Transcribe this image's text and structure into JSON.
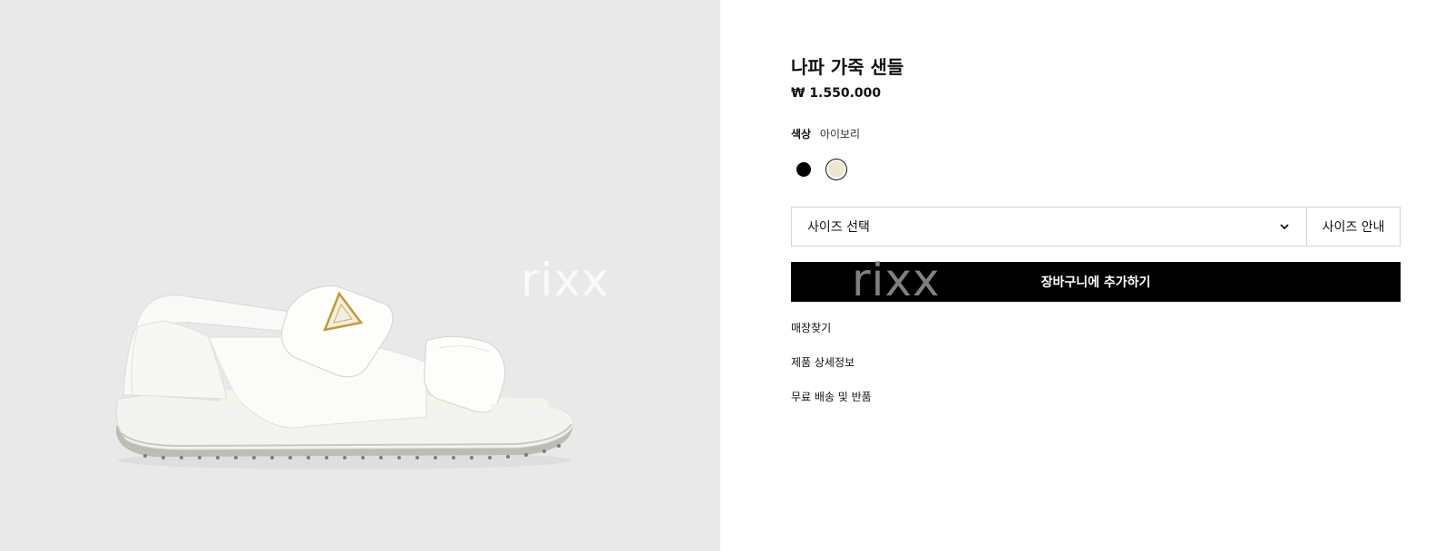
{
  "product": {
    "title": "나파 가죽 샌들",
    "price": "₩ 1.550.000",
    "image_alt": "white nappa leather sandal"
  },
  "color": {
    "label": "색상",
    "selected": "아이보리",
    "swatches": [
      {
        "name": "black",
        "hex": "#000000"
      },
      {
        "name": "ivory",
        "hex": "#efe6d2",
        "selected": true
      }
    ]
  },
  "size": {
    "placeholder": "사이즈 선택",
    "guide_label": "사이즈 안내"
  },
  "add_to_cart_label": "장바구니에 추가하기",
  "links": {
    "store": "매장찾기",
    "details": "제품 상세정보",
    "shipping": "무료 배송 및 반품"
  },
  "watermark": "rixx",
  "colors": {
    "image_background": "#e9e9e9",
    "button": "#000000",
    "border": "#d5d5d5"
  }
}
